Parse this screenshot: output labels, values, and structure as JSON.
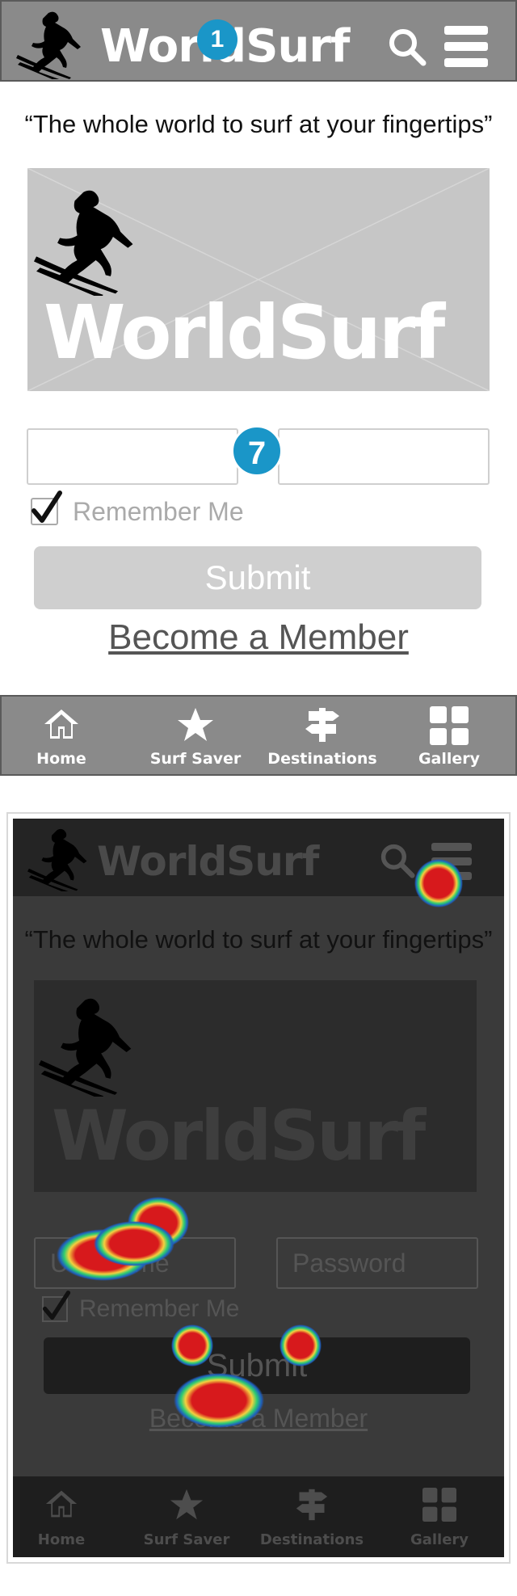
{
  "header": {
    "brand": "WorldSurf",
    "annotation_number": "1"
  },
  "tagline": "“The whole world to surf at your fingertips”",
  "hero": {
    "brand": "WorldSurf"
  },
  "login": {
    "annotation_number": "7",
    "username_placeholder": "Username",
    "password_placeholder": "Password",
    "remember_label": "Remember Me",
    "remember_checked": true,
    "submit_label": "Submit",
    "member_link": "Become a Member"
  },
  "tabs": [
    {
      "label": "Home",
      "icon": "home-icon"
    },
    {
      "label": "Surf Saver",
      "icon": "star-icon"
    },
    {
      "label": "Destinations",
      "icon": "signpost-icon"
    },
    {
      "label": "Gallery",
      "icon": "grid-icon"
    }
  ],
  "heatmap": {
    "brand": "WorldSurf",
    "tagline": "“The whole world to surf at your fingertips”",
    "hero_brand": "WorldSurf",
    "username": "Username",
    "password": "Password",
    "remember_label": "Remember Me",
    "submit_label": "Submit",
    "member_link": "Become a Member",
    "tabs": [
      "Home",
      "Surf Saver",
      "Destinations",
      "Gallery"
    ]
  },
  "colors": {
    "header_bg": "#8a8a8a",
    "badge": "#1a96c8",
    "placeholder_gray": "#c6c6c6",
    "heat_hot": "#d7191c",
    "heat_warm": "#f4d03f",
    "heat_cool": "#2ecc71",
    "heat_edge": "#1f5fbf"
  }
}
